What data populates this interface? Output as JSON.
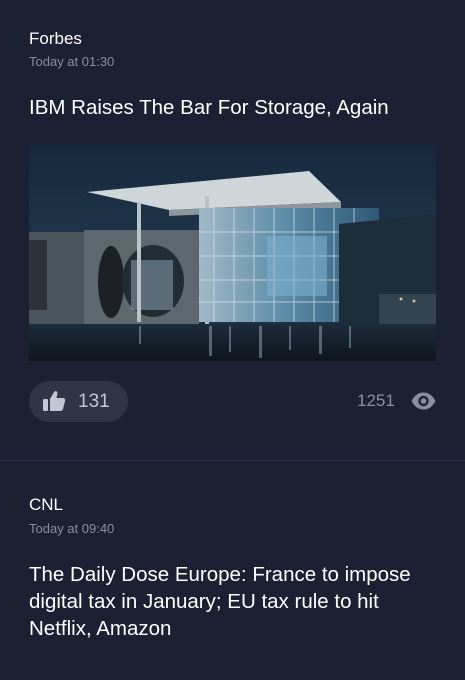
{
  "feed": {
    "articles": [
      {
        "source": "Forbes",
        "timestamp": "Today at 01:30",
        "headline": "IBM Raises The Bar For Storage, Again",
        "image_icon": "building-photo",
        "likes": "131",
        "views": "1251",
        "like_icon": "thumbs-up-icon",
        "view_icon": "eye-icon"
      },
      {
        "source": "CNL",
        "timestamp": "Today at 09:40",
        "headline": "The Daily Dose Europe: France to impose digital tax in January; EU tax rule to hit Netflix, Amazon"
      }
    ]
  },
  "colors": {
    "background": "#1c2033",
    "pill": "#2f3446",
    "muted_text": "#8a8fa0",
    "divider": "#2e3348"
  }
}
